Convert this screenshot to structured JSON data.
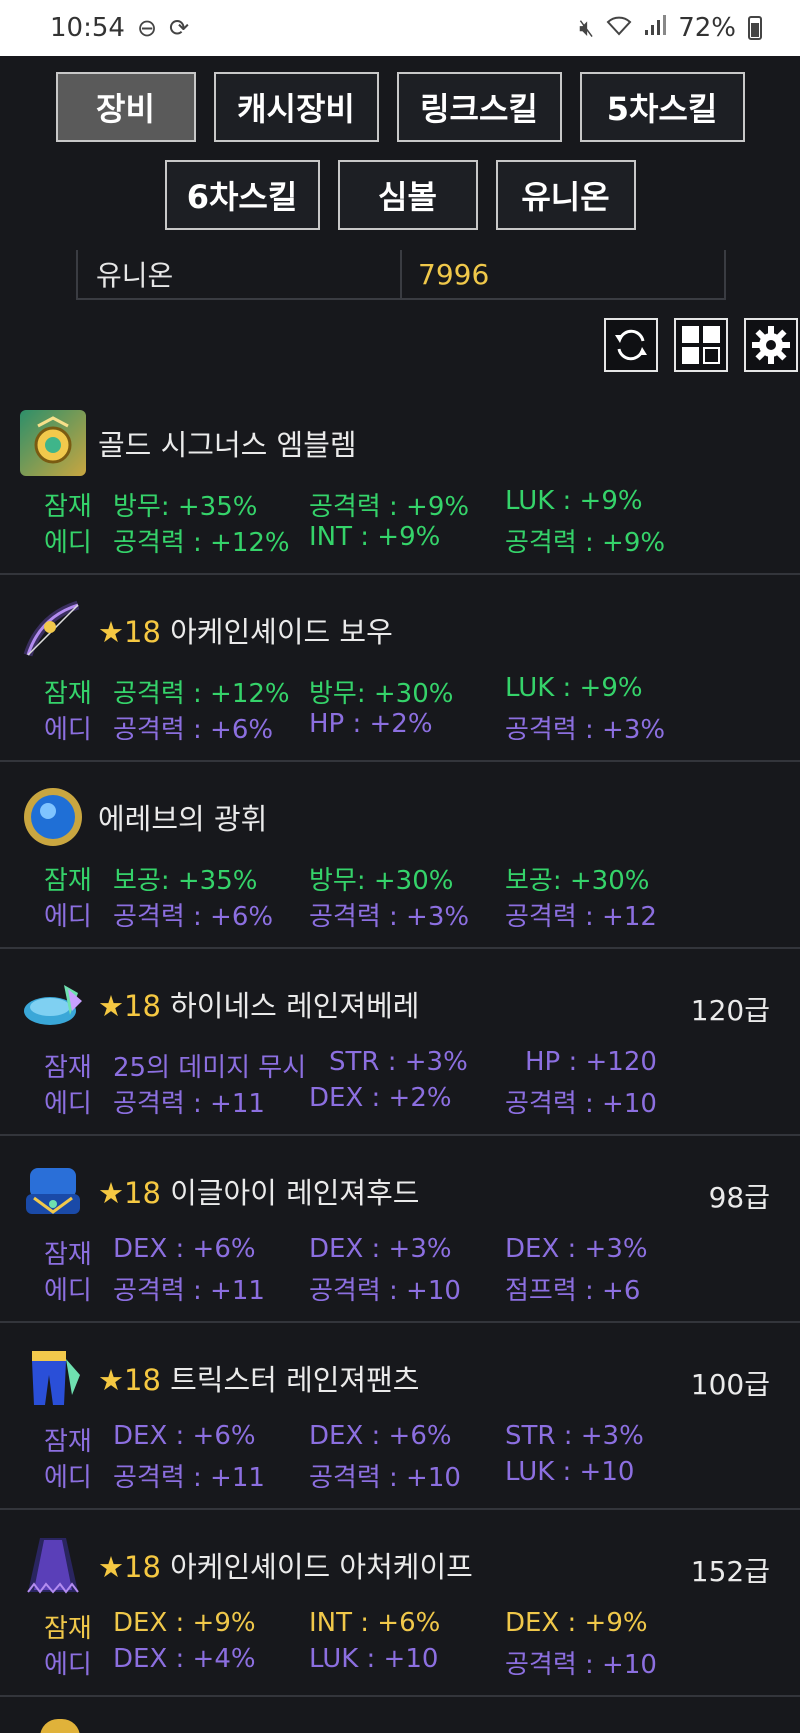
{
  "status": {
    "time": "10:54",
    "battery": "72%"
  },
  "tabs": {
    "row1": [
      "장비",
      "캐시장비",
      "링크스킬",
      "5차스킬"
    ],
    "row2": [
      "6차스킬",
      "심볼",
      "유니온"
    ]
  },
  "union": {
    "label": "유니온",
    "value": "7996"
  },
  "items": [
    {
      "name": "골드 시그너스 엠블렘",
      "star": "",
      "grade": "",
      "pot_label": "잠재",
      "add_label": "에디",
      "pot": [
        "방무: +35%",
        "공격력 : +9%",
        "LUK : +9%"
      ],
      "add": [
        "공격력 : +12%",
        "INT : +9%",
        "공격력 : +9%"
      ]
    },
    {
      "name": "아케인셰이드 보우",
      "star": "★18",
      "grade": "",
      "pot_label": "잠재",
      "add_label": "에디",
      "pot": [
        "공격력 : +12%",
        "방무: +30%",
        "LUK : +9%"
      ],
      "add": [
        "공격력 : +6%",
        "HP : +2%",
        "공격력 : +3%"
      ]
    },
    {
      "name": "에레브의 광휘",
      "star": "",
      "grade": "",
      "pot_label": "잠재",
      "add_label": "에디",
      "pot": [
        "보공: +35%",
        "방무: +30%",
        "보공: +30%"
      ],
      "add": [
        "공격력 : +6%",
        "공격력 : +3%",
        "공격력 : +12"
      ]
    },
    {
      "name": "하이네스 레인져베레",
      "star": "★18",
      "grade": "120급",
      "pot_label": "잠재",
      "add_label": "에디",
      "pot": [
        "25의 데미지 무시",
        "STR : +3%",
        "HP : +120"
      ],
      "add": [
        "공격력 : +11",
        "DEX : +2%",
        "공격력 : +10"
      ]
    },
    {
      "name": "이글아이 레인져후드",
      "star": "★18",
      "grade": "98급",
      "pot_label": "잠재",
      "add_label": "에디",
      "pot": [
        "DEX : +6%",
        "DEX : +3%",
        "DEX : +3%"
      ],
      "add": [
        "공격력 : +11",
        "공격력 : +10",
        "점프력 : +6"
      ]
    },
    {
      "name": "트릭스터 레인져팬츠",
      "star": "★18",
      "grade": "100급",
      "pot_label": "잠재",
      "add_label": "에디",
      "pot": [
        "DEX : +6%",
        "DEX : +6%",
        "STR : +3%"
      ],
      "add": [
        "공격력 : +11",
        "공격력 : +10",
        "LUK : +10"
      ]
    },
    {
      "name": "아케인셰이드 아처케이프",
      "star": "★18",
      "grade": "152급",
      "pot_label": "잠재",
      "add_label": "에디",
      "pot": [
        "DEX : +9%",
        "INT : +6%",
        "DEX : +9%"
      ],
      "add": [
        "DEX : +4%",
        "LUK : +10",
        "공격력 : +10"
      ]
    }
  ],
  "colors": {
    "legendary": "#35d36a",
    "epic_unique": "#8c6fe0",
    "unique_gold": "#f0c84a",
    "star": "#f5c842"
  },
  "icons": [
    "dnd-icon",
    "rotate-icon",
    "mute-icon",
    "wifi-icon",
    "signal-icon",
    "battery-icon",
    "refresh-icon",
    "grid-icon",
    "settings-icon"
  ]
}
